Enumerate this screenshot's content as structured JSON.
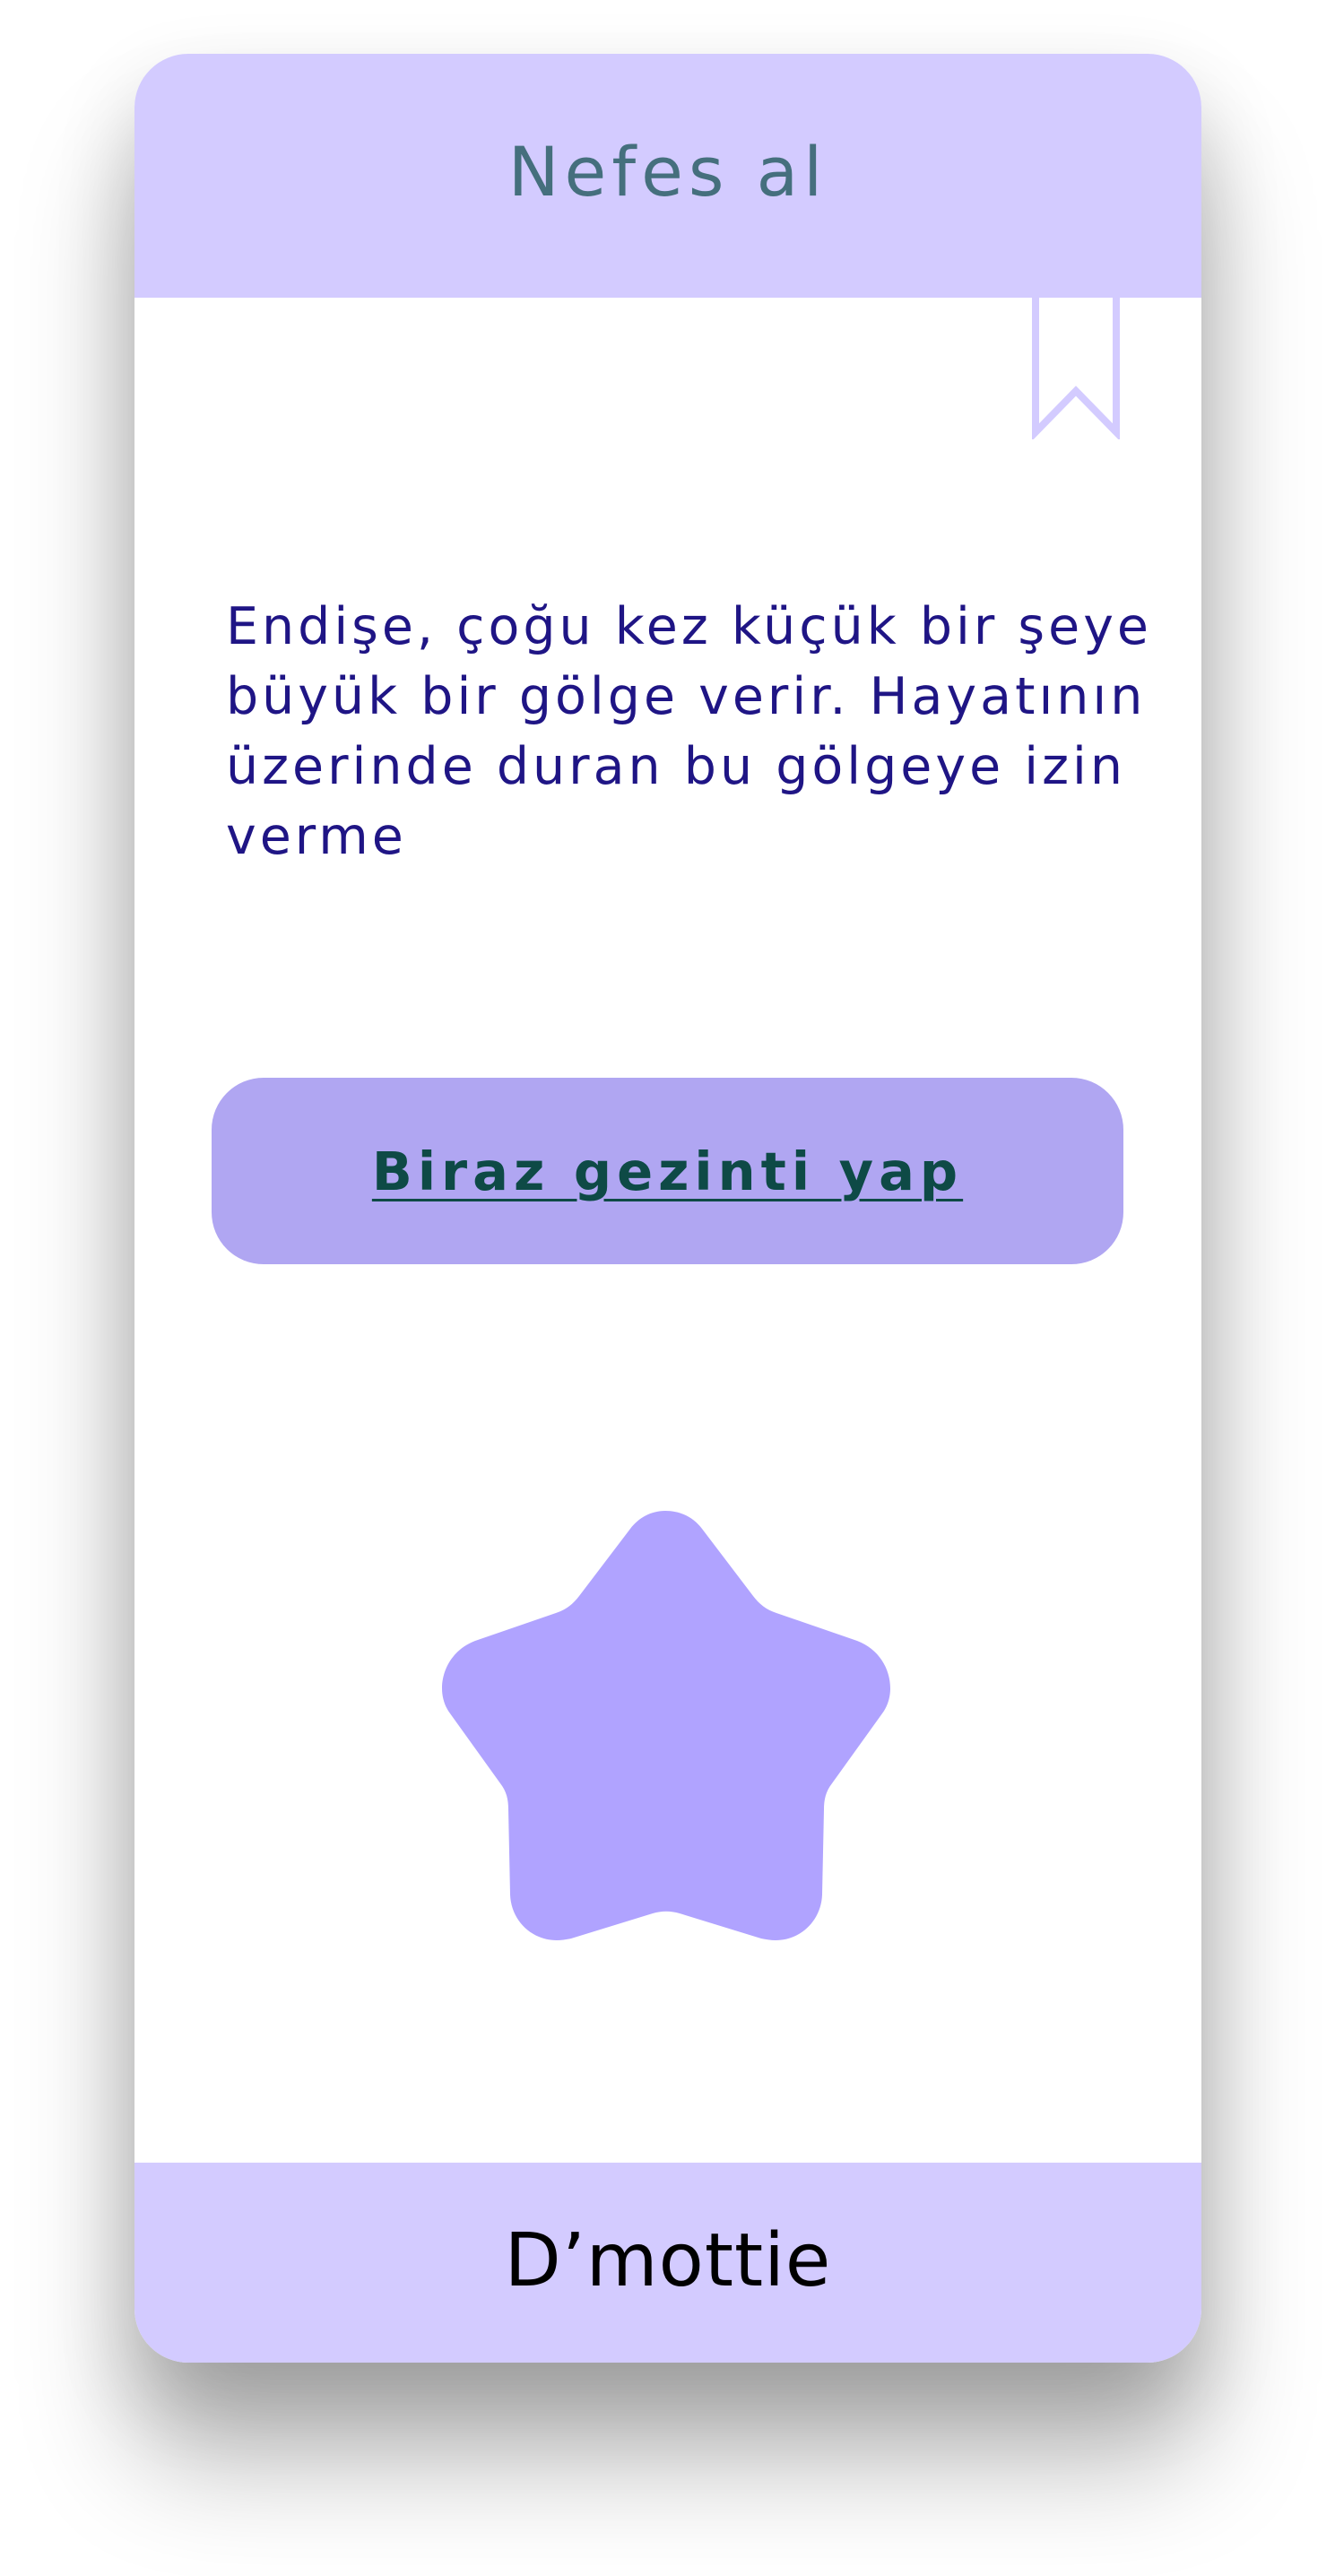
{
  "header": {
    "title": "Nefes al"
  },
  "bookmark": {
    "icon": "bookmark-icon",
    "color": "#d3cbff"
  },
  "quote": {
    "text": "Endişe, çoğu kez küçük bir şeye büyük bir gölge verir. Hayatının üzerinde duran bu gölgeye izin verme"
  },
  "cta": {
    "label": "Biraz gezinti yap",
    "color": "#b0a6f2"
  },
  "star": {
    "icon": "star-icon",
    "color": "#b0a3ff"
  },
  "footer": {
    "brand": "D’mottie"
  },
  "colors": {
    "accent_light": "#d3cbff",
    "text_primary": "#1f1585",
    "title_teal": "#456f7d",
    "button_text": "#0e4a46"
  }
}
